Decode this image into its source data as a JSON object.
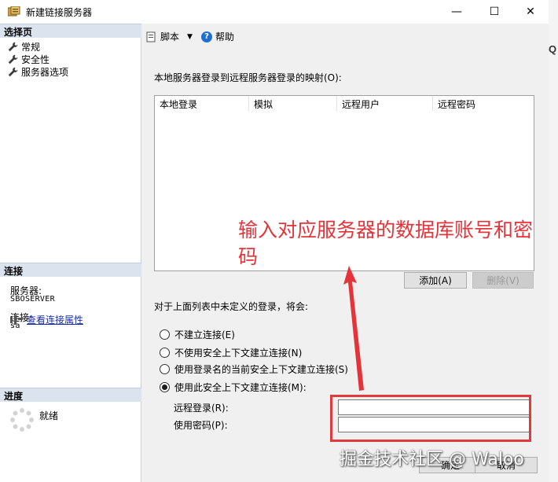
{
  "window": {
    "title": "新建链接服务器",
    "minimize_glyph": "—",
    "maximize_glyph": "☐",
    "close_glyph": "✕"
  },
  "left_pane": {
    "pages_header": "选择页",
    "pages": [
      "常规",
      "安全性",
      "服务器选项"
    ],
    "connection_header": "连接",
    "server_label": "服务器:",
    "server_value": "SBOSERVER",
    "login_label": "连接:",
    "login_value": "sa",
    "view_properties_link": "查看连接属性",
    "progress_header": "进度",
    "progress_status": "就绪"
  },
  "toolbar": {
    "script_label": "脚本",
    "help_label": "帮助"
  },
  "mapping": {
    "title": "本地服务器登录到远程服务器登录的映射(O):",
    "columns": [
      "本地登录",
      "模拟",
      "远程用户",
      "远程密码"
    ],
    "add_button": "添加(A)",
    "delete_button": "删除(V)"
  },
  "undefined_logins": {
    "label": "对于上面列表中未定义的登录，将会:",
    "options": [
      "不建立连接(E)",
      "不使用安全上下文建立连接(N)",
      "使用登录名的当前安全上下文建立连接(S)",
      "使用此安全上下文建立连接(M):"
    ],
    "selected_index": 3,
    "remote_login_label": "远程登录(R):",
    "remote_login_value": "",
    "password_label": "使用密码(P):",
    "password_value": ""
  },
  "footer": {
    "ok_button": "确定",
    "cancel_button": "取消"
  },
  "annotation": {
    "text": "输入对应服务器的数据库账号和密码",
    "color": "#e4343a"
  },
  "watermark": "掘金技术社区 @ Waloo",
  "right_edge_glyph": "Q"
}
